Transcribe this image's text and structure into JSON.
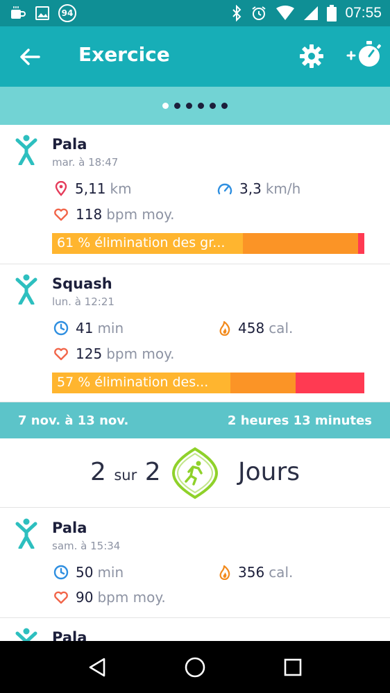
{
  "status_bar": {
    "notification_badge": "94",
    "time": "07:55",
    "icons": [
      "coffee-icon",
      "image-icon",
      "badge-icon",
      "bluetooth-icon",
      "alarm-icon",
      "wifi-icon",
      "signal-icon",
      "battery-icon"
    ]
  },
  "app_bar": {
    "title": "Exercice",
    "icons": [
      "back-arrow-icon",
      "gear-icon",
      "add-stopwatch-icon"
    ]
  },
  "pager": {
    "count": 6,
    "active_index": 0
  },
  "activities": [
    {
      "name": "Pala",
      "date": "mar. à 18:47",
      "metric1": {
        "icon": "location-pin-icon",
        "value": "5,11",
        "unit": "km"
      },
      "metric2": {
        "icon": "speed-gauge-icon",
        "value": "3,3",
        "unit": "km/h"
      },
      "metric3": {
        "icon": "heart-icon",
        "value": "118",
        "unit": "bpm moy."
      },
      "zone_label": "61 % élimination des gr...",
      "zones": {
        "fat_burn": 0.61,
        "cardio": 0.37,
        "peak": 0.02
      }
    },
    {
      "name": "Squash",
      "date": "lun. à 12:21",
      "metric1": {
        "icon": "clock-icon",
        "value": "41",
        "unit": "min"
      },
      "metric2": {
        "icon": "flame-icon",
        "value": "458",
        "unit": "cal."
      },
      "metric3": {
        "icon": "heart-icon",
        "value": "125",
        "unit": "bpm moy."
      },
      "zone_label": "57 % élimination des...",
      "zones": {
        "fat_burn": 0.57,
        "cardio": 0.21,
        "peak": 0.22
      }
    },
    {
      "name": "Pala",
      "date": "sam. à 15:34",
      "metric1": {
        "icon": "clock-icon",
        "value": "50",
        "unit": "min"
      },
      "metric2": {
        "icon": "flame-icon",
        "value": "356",
        "unit": "cal."
      },
      "metric3": {
        "icon": "heart-icon",
        "value": "90",
        "unit": "bpm moy."
      }
    },
    {
      "name": "Pala"
    }
  ],
  "week": {
    "range": "7 nov. à 13 nov.",
    "total": "2 heures 13 minutes"
  },
  "goal": {
    "achieved": "2",
    "separator": "sur",
    "target": "2",
    "unit": "Jours"
  },
  "colors": {
    "status_bar": "#0f8f95",
    "app_bar": "#17aeb7",
    "pager": "#72d3d4",
    "week_bar": "#5cc4c9",
    "fat_burn": "#ffb52f",
    "cardio": "#fb9426",
    "peak": "#ff3a52",
    "activity_icon": "#2dbfbf",
    "goal_badge": "#8fd12a"
  },
  "nav": {
    "icons": [
      "back-triangle-icon",
      "home-circle-icon",
      "recents-square-icon"
    ]
  }
}
